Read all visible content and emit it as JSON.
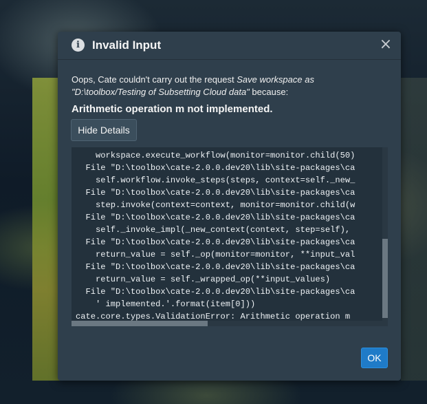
{
  "dialog": {
    "title": "Invalid Input",
    "info_icon": "info-icon",
    "close_icon": "×",
    "message_prefix": "Oops, Cate couldn't carry out the request ",
    "message_request": "Save workspace as \"D:\\toolbox/Testing of Subsetting Cloud data\"",
    "message_suffix": " because:",
    "error_message": "Arithmetic operation m not implemented.",
    "hide_details_label": "Hide Details",
    "ok_label": "OK",
    "traceback_lines": [
      "    workspace.execute_workflow(monitor=monitor.child(50)",
      "  File \"D:\\toolbox\\cate-2.0.0.dev20\\lib\\site-packages\\ca",
      "    self.workflow.invoke_steps(steps, context=self._new_",
      "  File \"D:\\toolbox\\cate-2.0.0.dev20\\lib\\site-packages\\ca",
      "    step.invoke(context=context, monitor=monitor.child(w",
      "  File \"D:\\toolbox\\cate-2.0.0.dev20\\lib\\site-packages\\ca",
      "    self._invoke_impl(_new_context(context, step=self),",
      "  File \"D:\\toolbox\\cate-2.0.0.dev20\\lib\\site-packages\\ca",
      "    return_value = self._op(monitor=monitor, **input_val",
      "  File \"D:\\toolbox\\cate-2.0.0.dev20\\lib\\site-packages\\ca",
      "    return_value = self._wrapped_op(**input_values)",
      "  File \"D:\\toolbox\\cate-2.0.0.dev20\\lib\\site-packages\\ca",
      "    ' implemented.'.format(item[0]))",
      "cate.core.types.ValidationError: Arithmetic operation m"
    ]
  },
  "colors": {
    "dialog_bg": "#2f3f4c",
    "ok_button": "#1f7bc8",
    "trace_bg": "#23313c"
  }
}
